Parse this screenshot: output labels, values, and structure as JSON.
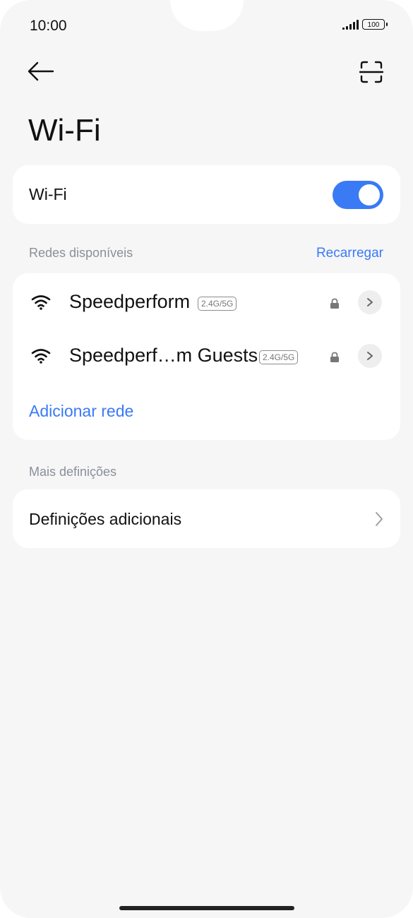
{
  "status_bar": {
    "time": "10:00",
    "battery": "100"
  },
  "header": {
    "back_icon": "arrow-left-icon",
    "scan_icon": "scan-qr-icon",
    "title": "Wi-Fi"
  },
  "wifi_toggle": {
    "label": "Wi-Fi",
    "state": "on",
    "color": "#3a7af5"
  },
  "available_networks": {
    "header": "Redes disponíveis",
    "refresh_label": "Recarregar",
    "networks": [
      {
        "name": "Speedperform",
        "band": "2.4G/5G",
        "secured": true
      },
      {
        "name": "Speedperf…m Guests",
        "band": "2.4G/5G",
        "secured": true
      }
    ],
    "add_network_label": "Adicionar rede"
  },
  "more_settings": {
    "header": "Mais definições",
    "item_label": "Definições adicionais"
  },
  "colors": {
    "accent": "#3a7af5",
    "background": "#f6f6f6",
    "card": "#ffffff",
    "secondary_text": "#8a8f99"
  }
}
